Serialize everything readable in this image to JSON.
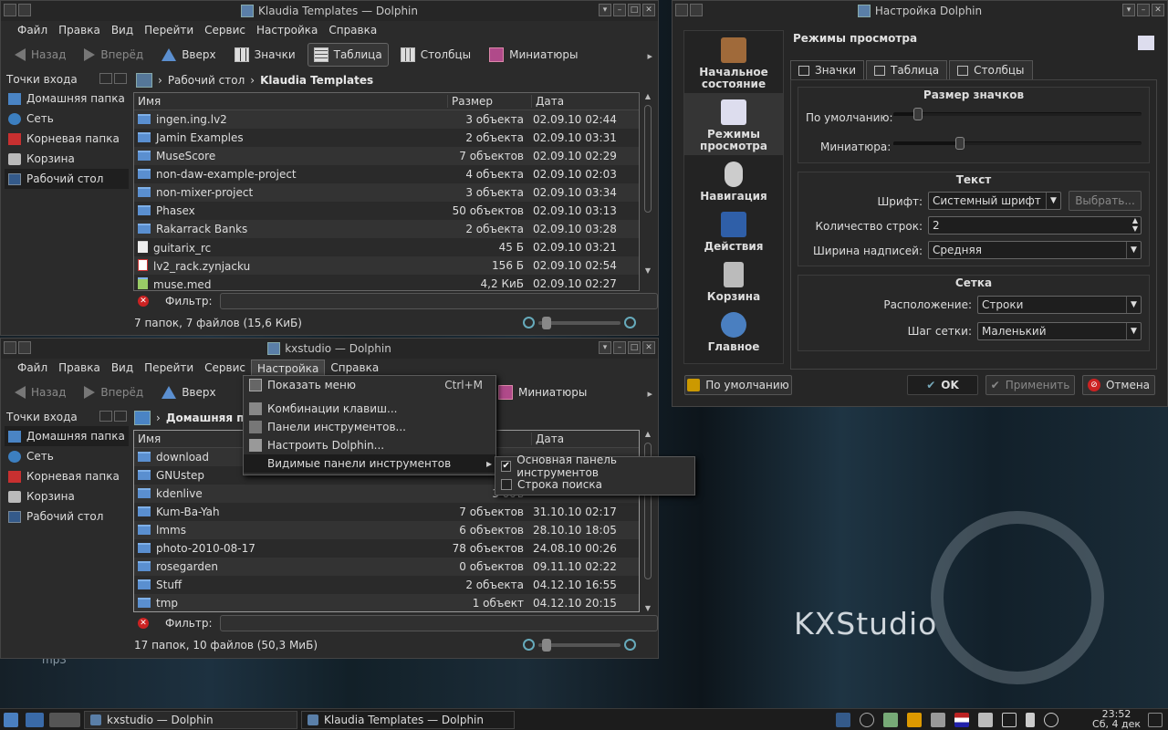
{
  "desktop": {
    "brand": "KXStudio",
    "stray_label": "mp3"
  },
  "win1": {
    "title": "Klaudia Templates — Dolphin",
    "menu": [
      "Файл",
      "Правка",
      "Вид",
      "Перейти",
      "Сервис",
      "Настройка",
      "Справка"
    ],
    "toolbar": {
      "back": "Назад",
      "forward": "Вперёд",
      "up": "Вверх",
      "icons": "Значки",
      "table": "Таблица",
      "columns": "Столбцы",
      "thumbs": "Миниатюры"
    },
    "places_title": "Точки входа",
    "places": [
      "Домашняя папка",
      "Сеть",
      "Корневая папка",
      "Корзина",
      "Рабочий стол"
    ],
    "crumb": {
      "first": "Рабочий стол",
      "last": "Klaudia Templates"
    },
    "headers": {
      "name": "Имя",
      "size": "Размер",
      "date": "Дата"
    },
    "rows": [
      {
        "name": "ingen.ing.lv2",
        "size": "3 объекта",
        "date": "02.09.10 02:44"
      },
      {
        "name": "Jamin Examples",
        "size": "2 объекта",
        "date": "02.09.10 03:31"
      },
      {
        "name": "MuseScore",
        "size": "7 объектов",
        "date": "02.09.10 02:29"
      },
      {
        "name": "non-daw-example-project",
        "size": "4 объекта",
        "date": "02.09.10 02:03"
      },
      {
        "name": "non-mixer-project",
        "size": "3 объекта",
        "date": "02.09.10 03:34"
      },
      {
        "name": "Phasex",
        "size": "50 объектов",
        "date": "02.09.10 03:13"
      },
      {
        "name": "Rakarrack Banks",
        "size": "2 объекта",
        "date": "02.09.10 03:28"
      },
      {
        "name": "guitarix_rc",
        "size": "45 Б",
        "date": "02.09.10 03:21"
      },
      {
        "name": "lv2_rack.zynjacku",
        "size": "156 Б",
        "date": "02.09.10 02:54"
      },
      {
        "name": "muse.med",
        "size": "4,2 КиБ",
        "date": "02.09.10 02:27"
      }
    ],
    "filter_label": "Фильтр:",
    "status": "7 папок, 7 файлов (15,6 КиБ)"
  },
  "win2": {
    "title": "kxstudio — Dolphin",
    "menu": [
      "Файл",
      "Правка",
      "Вид",
      "Перейти",
      "Сервис",
      "Настройка",
      "Справка"
    ],
    "toolbar": {
      "back": "Назад",
      "forward": "Вперёд",
      "up": "Вверх",
      "thumbs": "Миниатюры"
    },
    "places_title": "Точки входа",
    "places": [
      "Домашняя папка",
      "Сеть",
      "Корневая папка",
      "Корзина",
      "Рабочий стол"
    ],
    "crumb": "Домашняя па",
    "headers": {
      "name": "Имя",
      "date": "Дата"
    },
    "rows": [
      {
        "name": "download",
        "size": "",
        "date": ""
      },
      {
        "name": "GNUstep",
        "size": "",
        "date": ""
      },
      {
        "name": "kdenlive",
        "size": "3 объ",
        "date": ""
      },
      {
        "name": "Kum-Ba-Yah",
        "size": "7 объектов",
        "date": "31.10.10 02:17"
      },
      {
        "name": "lmms",
        "size": "6 объектов",
        "date": "28.10.10 18:05"
      },
      {
        "name": "photo-2010-08-17",
        "size": "78 объектов",
        "date": "24.08.10 00:26"
      },
      {
        "name": "rosegarden",
        "size": "0 объектов",
        "date": "09.11.10 02:22"
      },
      {
        "name": "Stuff",
        "size": "2 объекта",
        "date": "04.12.10 16:55"
      },
      {
        "name": "tmp",
        "size": "1 объект",
        "date": "04.12.10 20:15"
      }
    ],
    "filter_label": "Фильтр:",
    "status": "17 папок, 10 файлов (50,3 МиБ)"
  },
  "settings_menu": {
    "items": [
      {
        "label": "Показать меню",
        "shortcut": "Ctrl+M"
      },
      {
        "label": "Комбинации клавиш..."
      },
      {
        "label": "Панели инструментов..."
      },
      {
        "label": "Настроить Dolphin..."
      },
      {
        "label": "Видимые панели инструментов"
      }
    ],
    "submenu": [
      {
        "label": "Основная панель инструментов",
        "checked": true
      },
      {
        "label": "Строка поиска",
        "checked": false
      }
    ]
  },
  "config": {
    "title": "Настройка Dolphin",
    "side": [
      "Начальное состояние",
      "Режимы просмотра",
      "Навигация",
      "Действия",
      "Корзина",
      "Главное"
    ],
    "page_title": "Режимы просмотра",
    "tabs": [
      "Значки",
      "Таблица",
      "Столбцы"
    ],
    "icon_size": {
      "title": "Размер значков",
      "default_label": "По умолчанию:",
      "thumb_label": "Миниатюра:",
      "default_level": 0.1,
      "thumb_level": 0.27
    },
    "text": {
      "title": "Текст",
      "font_label": "Шрифт:",
      "font_value": "Системный шрифт",
      "choose": "Выбрать...",
      "lines_label": "Количество строк:",
      "lines_value": "2",
      "width_label": "Ширина надписей:",
      "width_value": "Средняя"
    },
    "grid": {
      "title": "Сетка",
      "arr_label": "Расположение:",
      "arr_value": "Строки",
      "step_label": "Шаг сетки:",
      "step_value": "Маленький"
    },
    "buttons": {
      "defaults": "По умолчанию",
      "ok": "OK",
      "apply": "Применить",
      "cancel": "Отмена"
    }
  },
  "taskbar": {
    "task1": "kxstudio — Dolphin",
    "task2": "Klaudia Templates — Dolphin",
    "time": "23:52",
    "date": "Сб, 4 дек"
  }
}
